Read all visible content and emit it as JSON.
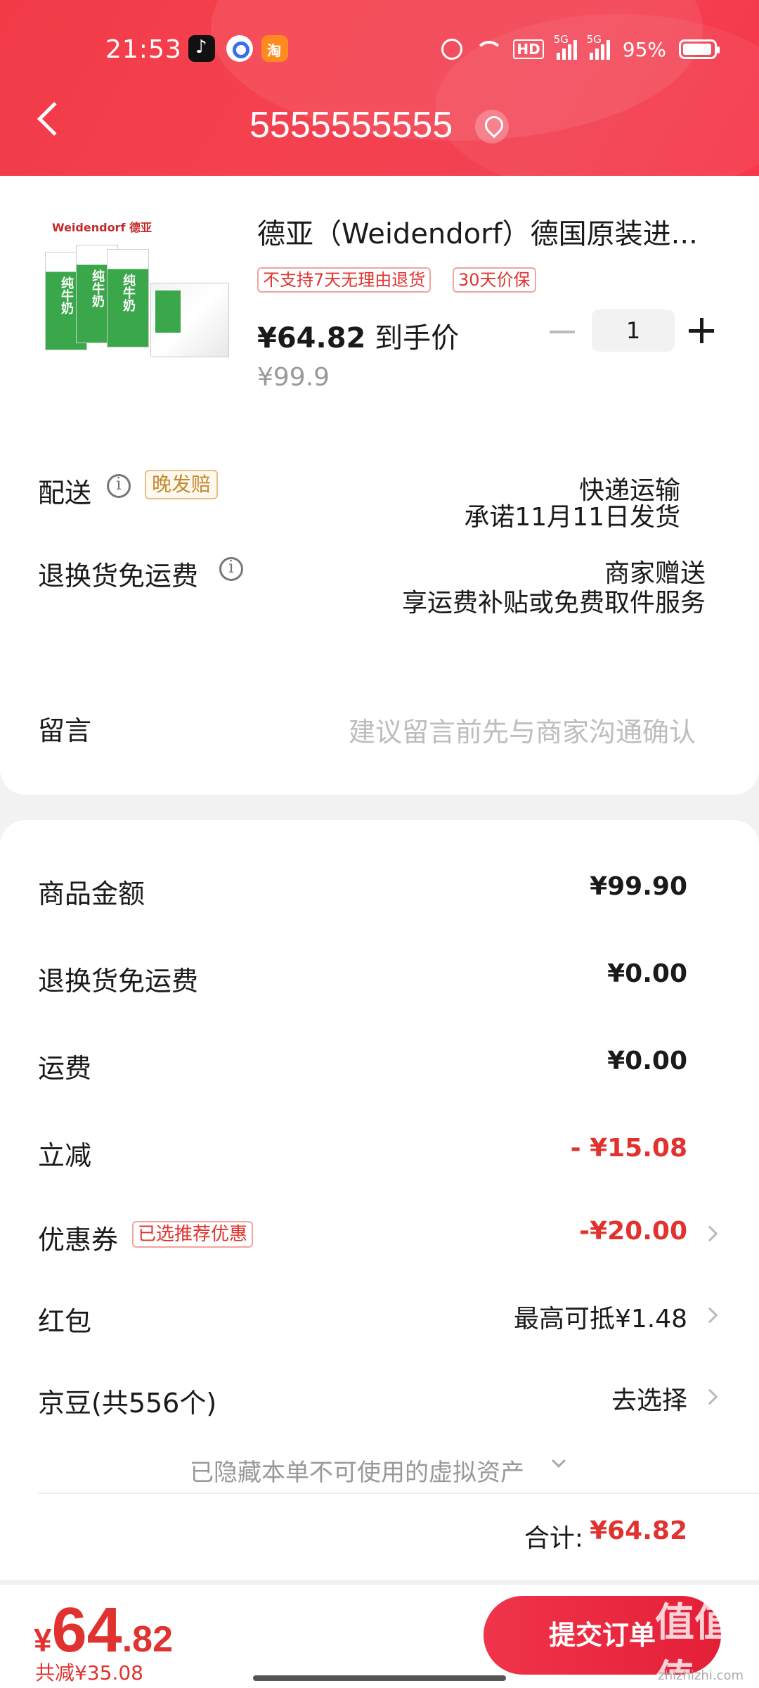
{
  "status_bar": {
    "time": "21:53",
    "battery": "95%",
    "network_1": "5G",
    "network_2": "5G",
    "hd": "HD"
  },
  "header": {
    "address": "5555555555"
  },
  "product": {
    "title": "德亚（Weidendorf）德国原装进...",
    "brand": "Weidendorf 德亚",
    "tags": [
      "不支持7天无理由退货",
      "30天价保"
    ],
    "final_price": "¥64.82",
    "final_price_label": " 到手价",
    "original_price": "¥99.9",
    "quantity": "1"
  },
  "delivery": {
    "label": "配送",
    "badge": "晚发赔",
    "method": "快递运输",
    "promise": "承诺11月11日发货"
  },
  "return_shipping": {
    "label": "退换货免运费",
    "value": "商家赠送",
    "desc": "享运费补贴或免费取件服务"
  },
  "message": {
    "label": "留言",
    "placeholder": "建议留言前先与商家沟通确认"
  },
  "summary": {
    "goods_amount_label": "商品金额",
    "goods_amount": "¥99.90",
    "return_fee_label": "退换货免运费",
    "return_fee": "¥0.00",
    "shipping_label": "运费",
    "shipping": "¥0.00",
    "instant_discount_label": "立减",
    "instant_discount": "- ¥15.08",
    "coupon_label": "优惠券",
    "coupon_tag": "已选推荐优惠",
    "coupon": "-¥20.00",
    "red_packet_label": "红包",
    "red_packet": "最高可抵¥1.48",
    "jingdou_label": "京豆(共556个)",
    "jingdou": "去选择",
    "hidden_assets": "已隐藏本单不可使用的虚拟资产",
    "total_label": "合计:",
    "total": "¥64.82"
  },
  "bottom": {
    "currency": "¥",
    "price_int": "64",
    "price_dec": ".82",
    "saving": "共减¥35.08",
    "submit": "提交订单",
    "watermark": "值值值",
    "watermark_site": "zhizhizhi.com"
  },
  "colors": {
    "brand_red": "#f23a47",
    "price_red": "#e0332f",
    "gold": "#c28a32"
  }
}
